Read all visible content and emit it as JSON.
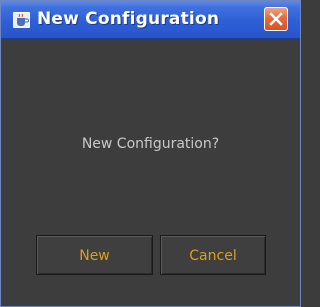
{
  "window": {
    "title": "New Configuration",
    "icon": "java-cup-icon",
    "close_icon": "close-icon"
  },
  "dialog": {
    "message": "New Configuration?",
    "buttons": {
      "new_label": "New",
      "cancel_label": "Cancel"
    }
  },
  "colors": {
    "titlebar": "#2e5fd6",
    "background": "#3d3d3d",
    "button_text": "#d9a11e",
    "message_text": "#c8c8c8",
    "close_button": "#e66a3f"
  }
}
